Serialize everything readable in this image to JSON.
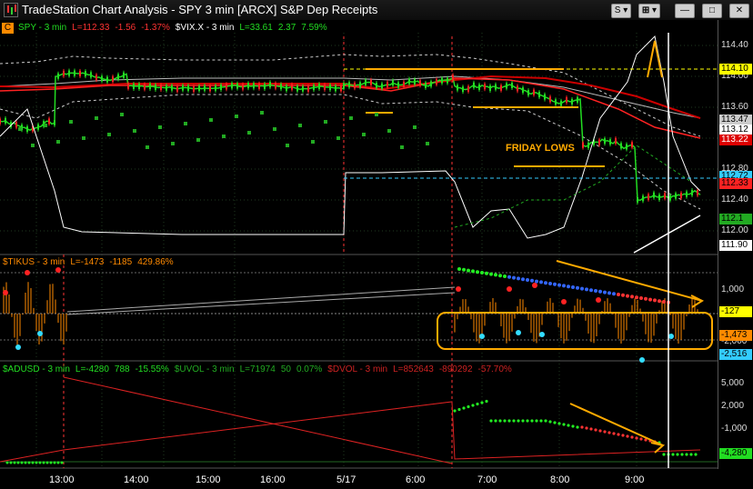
{
  "window": {
    "title": "TradeStation Chart Analysis - SPY 3 min [ARCX] S&P Dep Receipts"
  },
  "window_buttons": {
    "s": "S",
    "link": "▾",
    "minimize": "—",
    "maximize": "□",
    "close": "✕"
  },
  "panel1": {
    "badge": "C",
    "legend": [
      {
        "text": "SPY - 3 min",
        "color": "#22dd22"
      },
      {
        "text": "L=112.33",
        "color": "#ff3333"
      },
      {
        "text": "-1.56",
        "color": "#ff3333"
      },
      {
        "text": "-1.37%",
        "color": "#ff3333"
      },
      {
        "text": "$VIX.X - 3 min",
        "color": "#ffffff"
      },
      {
        "text": "L=33.61",
        "color": "#22dd22"
      },
      {
        "text": "2.37",
        "color": "#22dd22"
      },
      {
        "text": "7.59%",
        "color": "#22dd22"
      }
    ],
    "annotation": "FRIDAY LOWS",
    "price_ticks": [
      "114.40",
      "114.00",
      "113.60",
      "113.20",
      "112.80",
      "112.40",
      "112.00"
    ],
    "price_labels": [
      {
        "text": "114.10",
        "bg": "#ffff00",
        "fg": "#000000"
      },
      {
        "text": "113.47",
        "bg": "#cccccc",
        "fg": "#000000"
      },
      {
        "text": "113.12",
        "bg": "#ffffff",
        "fg": "#000000"
      },
      {
        "text": "113.22",
        "bg": "#dd0000",
        "fg": "#ffffff"
      },
      {
        "text": "112.72",
        "bg": "#33ccff",
        "fg": "#000000"
      },
      {
        "text": "112.33",
        "bg": "#ff2222",
        "fg": "#000000"
      },
      {
        "text": "112.1",
        "bg": "#22aa22",
        "fg": "#000000"
      },
      {
        "text": "111.90",
        "bg": "#ffffff",
        "fg": "#000000"
      }
    ]
  },
  "panel2": {
    "legend": [
      {
        "text": "$TIKUS - 3 min",
        "color": "#ff8a00"
      },
      {
        "text": "L=-1473",
        "color": "#ff8a00"
      },
      {
        "text": "-1185",
        "color": "#ff8a00"
      },
      {
        "text": "429.86%",
        "color": "#ff8a00"
      }
    ],
    "ticks": [
      "1,000",
      "-2,000"
    ],
    "labels": [
      {
        "text": "-127",
        "bg": "#ffff00",
        "fg": "#000000"
      },
      {
        "text": "-1,473",
        "bg": "#ff8a00",
        "fg": "#000000"
      },
      {
        "text": "-2,516",
        "bg": "#33ccff",
        "fg": "#000000"
      }
    ]
  },
  "panel3": {
    "legend": [
      {
        "text": "$ADUSD - 3 min",
        "color": "#22dd22"
      },
      {
        "text": "L=-4280",
        "color": "#22dd22"
      },
      {
        "text": "788",
        "color": "#22dd22"
      },
      {
        "text": "-15.55%",
        "color": "#22dd22"
      },
      {
        "text": "$UVOL - 3 min",
        "color": "#22aa22"
      },
      {
        "text": "L=71974",
        "color": "#22aa22"
      },
      {
        "text": "50",
        "color": "#22aa22"
      },
      {
        "text": "0.07%",
        "color": "#22aa22"
      },
      {
        "text": "$DVOL - 3 min",
        "color": "#cc2222"
      },
      {
        "text": "L=852643",
        "color": "#cc2222"
      },
      {
        "text": "-890292",
        "color": "#cc2222"
      },
      {
        "text": "-57.70%",
        "color": "#cc2222"
      }
    ],
    "ticks": [
      "5,000",
      "2,000",
      "-1,000"
    ],
    "labels": [
      {
        "text": "-4,280",
        "bg": "#22dd22",
        "fg": "#000000"
      }
    ]
  },
  "time_axis": [
    "13:00",
    "14:00",
    "15:00",
    "16:00",
    "5/17",
    "6:00",
    "7:00",
    "8:00",
    "9:00"
  ]
}
